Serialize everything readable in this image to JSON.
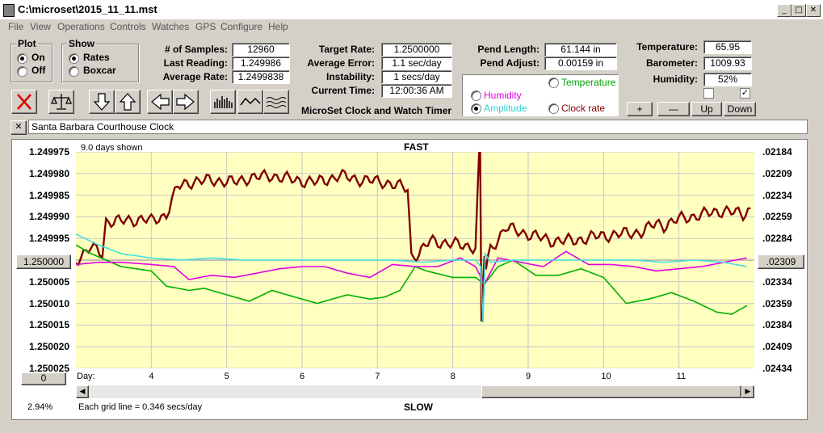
{
  "window": {
    "title": "C:\\microset\\2015_11_11.mst",
    "min_glyph": "_",
    "max_glyph": "□",
    "close_glyph": "✕"
  },
  "menu": [
    "File",
    "View",
    "Operations",
    "Controls",
    "Watches",
    "GPS",
    "Configure",
    "Help"
  ],
  "plot_group": {
    "title": "Plot",
    "on": "On",
    "off": "Off",
    "selected": "On"
  },
  "show_group": {
    "title": "Show",
    "rates": "Rates",
    "boxcar": "Boxcar",
    "selected": "Rates"
  },
  "stats": {
    "samples_label": "# of Samples:",
    "samples": "12960",
    "last_label": "Last Reading:",
    "last": "1.249986",
    "avg_label": "Average Rate:",
    "avg": "1.2499838",
    "target_label": "Target Rate:",
    "target": "1.2500000",
    "avgerr_label": "Average Error:",
    "avgerr": "1.1 sec/day",
    "instab_label": "Instability:",
    "instab": "1 secs/day",
    "time_label": "Current Time:",
    "time": "12:00:36 AM",
    "pendlen_label": "Pend Length:",
    "pendlen": "61.144 in",
    "pendadj_label": "Pend Adjust:",
    "pendadj": "0.00159 in",
    "temp_label": "Temperature:",
    "temp": "65.95",
    "baro_label": "Barometer:",
    "baro": "1009.93",
    "hum_label": "Humidity:",
    "hum": "52%"
  },
  "app_caption": "MicroSet Clock and Watch Timer",
  "aux": {
    "temperature": "Temperature",
    "humidity": "Humidity",
    "amplitude": "Amplitude",
    "clockrate": "Clock rate",
    "selected": "Amplitude"
  },
  "adj_buttons": {
    "plus": "+",
    "minus": "—",
    "up": "Up",
    "down": "Down"
  },
  "clock_name": "Santa Barbara Courthouse Clock",
  "clear_btn": "✕",
  "plot": {
    "days_shown": "9.0 days shown",
    "fast": "FAST",
    "slow": "SLOW",
    "day_label": "Day:",
    "grid_note": "Each grid line = 0.346 secs/day",
    "percent": "2.94%",
    "left_center": "1.250000",
    "right_center": ".02309",
    "bottom_left_value": "0"
  },
  "colors": {
    "rate": "#800000",
    "temperature": "#00b000",
    "humidity": "#e000e0",
    "amplitude": "#40e0e0",
    "grid": "#c8c8c8",
    "bg": "#ffffc0"
  },
  "chart_data": {
    "type": "line",
    "x_ticks": [
      "4",
      "5",
      "6",
      "7",
      "8",
      "9",
      "10",
      "11"
    ],
    "left_ticks": [
      "1.249975",
      "1.249980",
      "1.249985",
      "1.249990",
      "1.249995",
      "1.250000",
      "1.250005",
      "1.250010",
      "1.250015",
      "1.250020",
      "1.250025"
    ],
    "right_ticks": [
      ".02184",
      ".02209",
      ".02234",
      ".02259",
      ".02284",
      ".02309",
      ".02334",
      ".02359",
      ".02384",
      ".02409",
      ".02434"
    ],
    "ylim": [
      1.249975,
      1.250025
    ],
    "xlim": [
      3.0,
      12.0
    ],
    "series": [
      {
        "name": "Rate",
        "color": "#800000",
        "x": [
          3.0,
          3.2,
          3.35,
          3.4,
          3.6,
          3.9,
          4.0,
          4.2,
          4.35,
          4.5,
          4.8,
          5.1,
          5.3,
          5.6,
          5.9,
          6.2,
          6.5,
          6.8,
          7.1,
          7.4,
          7.45,
          7.55,
          7.7,
          7.9,
          8.1,
          8.3,
          8.36,
          8.38,
          8.4,
          8.42,
          8.44,
          8.5,
          8.7,
          9.0,
          9.3,
          9.6,
          9.9,
          10.2,
          10.5,
          10.7,
          10.8,
          11.0,
          11.3,
          11.6,
          11.85,
          11.95
        ],
        "y": [
          1.25,
          1.249997,
          1.2499985,
          1.249991,
          1.249991,
          1.2499905,
          1.249991,
          1.2499895,
          1.249983,
          1.249982,
          1.2499815,
          1.249982,
          1.249981,
          1.2499805,
          1.2499815,
          1.249982,
          1.2499805,
          1.2499815,
          1.249982,
          1.2499835,
          1.249999,
          1.2499985,
          1.2499955,
          1.249996,
          1.2499965,
          1.249997,
          1.2499715,
          1.2500145,
          1.250005,
          1.2499985,
          1.250002,
          1.2499975,
          1.2499925,
          1.249994,
          1.2499955,
          1.2499955,
          1.2499945,
          1.249994,
          1.2499935,
          1.2499915,
          1.249992,
          1.2499905,
          1.2499895,
          1.2499885,
          1.2499895,
          1.249988
        ]
      },
      {
        "name": "Temperature",
        "color": "#00b000",
        "x": [
          3.0,
          3.2,
          3.4,
          3.6,
          4.0,
          4.2,
          4.5,
          4.7,
          5.0,
          5.3,
          5.6,
          5.9,
          6.2,
          6.6,
          6.9,
          7.1,
          7.3,
          7.5,
          7.65,
          8.0,
          8.3,
          8.42,
          8.6,
          8.8,
          9.1,
          9.4,
          9.7,
          10.0,
          10.3,
          10.6,
          10.9,
          11.2,
          11.5,
          11.7,
          11.9
        ],
        "y": [
          1.2499965,
          1.2499985,
          1.25,
          1.2500015,
          1.2500025,
          1.250006,
          1.250007,
          1.2500065,
          1.250008,
          1.2500095,
          1.250007,
          1.2500085,
          1.25001,
          1.250008,
          1.250009,
          1.2500085,
          1.250007,
          1.2500015,
          1.2500025,
          1.250004,
          1.250004,
          1.2500055,
          1.2500015,
          1.25,
          1.2500035,
          1.2500035,
          1.250002,
          1.250004,
          1.25001,
          1.250009,
          1.2500075,
          1.2500095,
          1.250012,
          1.2500125,
          1.2500105
        ]
      },
      {
        "name": "Humidity",
        "color": "#e000e0",
        "x": [
          3.0,
          3.3,
          3.6,
          4.0,
          4.3,
          4.5,
          4.8,
          5.1,
          5.4,
          5.7,
          6.0,
          6.3,
          6.6,
          6.9,
          7.2,
          7.5,
          7.8,
          8.1,
          8.3,
          8.42,
          8.6,
          8.9,
          9.2,
          9.5,
          9.8,
          10.1,
          10.4,
          10.7,
          11.0,
          11.3,
          11.6,
          11.9
        ],
        "y": [
          1.250001,
          1.2500005,
          1.2500005,
          1.250001,
          1.2500015,
          1.2500045,
          1.2500035,
          1.250004,
          1.250003,
          1.250002,
          1.2500015,
          1.2500015,
          1.250003,
          1.250004,
          1.250001,
          1.2500015,
          1.2500015,
          1.2499995,
          1.2500015,
          1.2500055,
          1.2499995,
          1.2500005,
          1.2500015,
          1.249998,
          1.250001,
          1.250001,
          1.2500015,
          1.2500025,
          1.250002,
          1.2500015,
          1.2500005,
          1.2499995
        ]
      },
      {
        "name": "Amplitude",
        "color": "#40e0e0",
        "x": [
          3.0,
          3.3,
          3.6,
          4.0,
          4.4,
          4.8,
          5.2,
          5.6,
          6.0,
          6.4,
          6.8,
          7.2,
          7.6,
          8.0,
          8.3,
          8.37,
          8.4,
          8.43,
          8.5,
          8.8,
          9.2,
          9.6,
          10.0,
          10.4,
          10.8,
          11.2,
          11.6,
          11.9
        ],
        "y": [
          1.249994,
          1.2499965,
          1.2499985,
          1.2499995,
          1.25,
          1.2499995,
          1.25,
          1.25,
          1.25,
          1.25,
          1.25,
          1.25,
          1.2500005,
          1.25,
          1.25,
          1.2500015,
          1.2500145,
          1.2499985,
          1.2500005,
          1.25,
          1.25,
          1.25,
          1.25,
          1.25,
          1.2500005,
          1.25,
          1.2500005,
          1.2500015
        ]
      }
    ]
  }
}
